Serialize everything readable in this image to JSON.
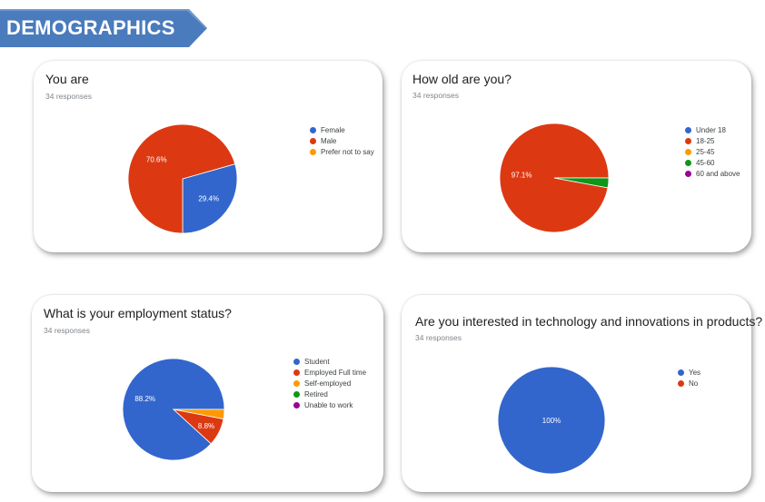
{
  "header": {
    "title": "DEMOGRAPHICS",
    "color": "#4a7bbd"
  },
  "charts": [
    {
      "title": "You are",
      "responses": "34 responses",
      "chart_data": {
        "type": "pie",
        "title": "You are",
        "categories": [
          "Female",
          "Male",
          "Prefer not to say"
        ],
        "values": [
          29.4,
          70.6,
          0
        ],
        "colors": [
          "#3366cc",
          "#dc3912",
          "#ff9900"
        ],
        "labels": [
          "29.4%",
          "70.6%",
          ""
        ]
      }
    },
    {
      "title": "How old are you?",
      "responses": "34 responses",
      "chart_data": {
        "type": "pie",
        "title": "How old are you?",
        "categories": [
          "Under 18",
          "18-25",
          "25-45",
          "45-60",
          "60 and above"
        ],
        "values": [
          0,
          97.1,
          0,
          2.9,
          0
        ],
        "colors": [
          "#3366cc",
          "#dc3912",
          "#ff9900",
          "#109618",
          "#990099"
        ],
        "labels": [
          "",
          "97.1%",
          "",
          "",
          ""
        ]
      }
    },
    {
      "title": "What is your employment status?",
      "responses": "34 responses",
      "chart_data": {
        "type": "pie",
        "title": "What is your employment status?",
        "categories": [
          "Student",
          "Employed Full time",
          "Self-employed",
          "Retired",
          "Unable to work"
        ],
        "values": [
          88.2,
          8.8,
          3.0,
          0,
          0
        ],
        "colors": [
          "#3366cc",
          "#dc3912",
          "#ff9900",
          "#109618",
          "#990099"
        ],
        "labels": [
          "88.2%",
          "8.8%",
          "",
          "",
          ""
        ]
      }
    },
    {
      "title": "Are you interested in technology and innovations in products?",
      "responses": "34 responses",
      "chart_data": {
        "type": "pie",
        "title": "Are you interested in technology and innovations in products?",
        "categories": [
          "Yes",
          "No"
        ],
        "values": [
          100,
          0
        ],
        "colors": [
          "#3366cc",
          "#dc3912"
        ],
        "labels": [
          "100%",
          ""
        ]
      }
    }
  ]
}
